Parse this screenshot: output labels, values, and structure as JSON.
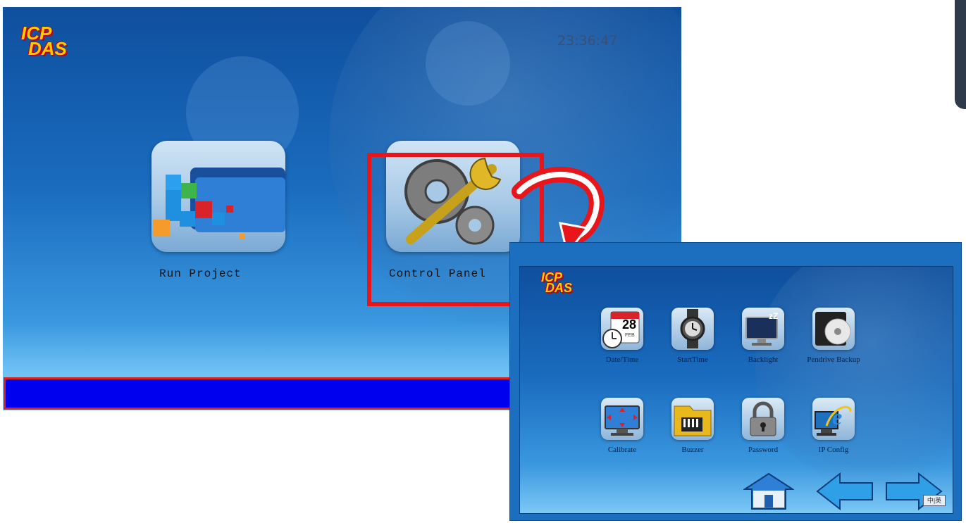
{
  "main_screen": {
    "logo": {
      "line1": "ICP",
      "line2": "DAS"
    },
    "clock": "23:36:47",
    "apps": [
      {
        "label": "Run Project",
        "icon": "folder-blocks-icon"
      },
      {
        "label": "Control Panel",
        "icon": "gears-wrench-icon"
      }
    ],
    "status_text": ""
  },
  "control_panel": {
    "logo": {
      "line1": "ICP",
      "line2": "DAS"
    },
    "calendar_day": "28",
    "calendar_month": "FEB",
    "items": [
      {
        "label": "Date/Time",
        "icon": "calendar-clock-icon"
      },
      {
        "label": "StartTime",
        "icon": "watch-icon"
      },
      {
        "label": "Backlight",
        "icon": "monitor-sleep-icon"
      },
      {
        "label": "Pendrive Backup",
        "icon": "disc-icon"
      },
      {
        "label": "Calibrate",
        "icon": "monitor-calibrate-icon"
      },
      {
        "label": "Buzzer",
        "icon": "buzzer-icon"
      },
      {
        "label": "Password",
        "icon": "padlock-icon"
      },
      {
        "label": "IP Config",
        "icon": "ie-network-icon"
      }
    ],
    "nav": {
      "home": "home-icon",
      "back": "arrow-left-icon",
      "forward": "arrow-right-icon"
    },
    "language_toggle": "中|英"
  },
  "colors": {
    "highlight": "#e8151a",
    "status_bar": "#0000ee",
    "frame": "#1c6fbe"
  }
}
